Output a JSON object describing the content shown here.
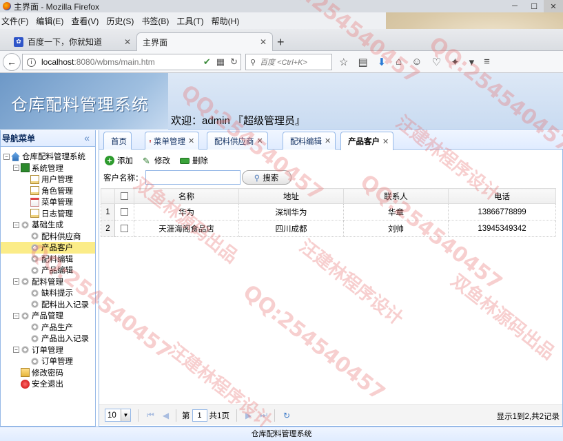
{
  "browser": {
    "window_title": "主界面 - Mozilla Firefox",
    "menus": [
      "文件(F)",
      "编辑(E)",
      "查看(V)",
      "历史(S)",
      "书签(B)",
      "工具(T)",
      "帮助(H)"
    ],
    "tabs": [
      {
        "label": "百度一下，你就知道"
      },
      {
        "label": "主界面"
      }
    ],
    "url_host": "localhost",
    "url_path": ":8080/wbms/main.htm",
    "search_placeholder": "百度 <Ctrl+K>"
  },
  "app": {
    "title": "仓库配料管理系统",
    "welcome": "欢迎：admin 『超级管理员』",
    "footer": "仓库配料管理系统"
  },
  "sidebar": {
    "title": "导航菜单",
    "tree": [
      {
        "label": "仓库配料管理系统",
        "level": 0,
        "icon": "home-icon",
        "exp": "⊟"
      },
      {
        "label": "系统管理",
        "level": 1,
        "icon": "book-icon",
        "exp": "⊟"
      },
      {
        "label": "用户管理",
        "level": 2,
        "icon": "page-icon"
      },
      {
        "label": "角色管理",
        "level": 2,
        "icon": "page-icon"
      },
      {
        "label": "菜单管理",
        "level": 2,
        "icon": "menu-icon"
      },
      {
        "label": "日志管理",
        "level": 2,
        "icon": "page-icon"
      },
      {
        "label": "基础生成",
        "level": 1,
        "icon": "gear-icon",
        "exp": "⊟"
      },
      {
        "label": "配料供应商",
        "level": 2,
        "icon": "gear-icon"
      },
      {
        "label": "产品客户",
        "level": 2,
        "icon": "gear-icon",
        "selected": true
      },
      {
        "label": "配料编辑",
        "level": 2,
        "icon": "gear-icon"
      },
      {
        "label": "产品编辑",
        "level": 2,
        "icon": "gear-icon"
      },
      {
        "label": "配料管理",
        "level": 1,
        "icon": "gear-icon",
        "exp": "⊟"
      },
      {
        "label": "缺料提示",
        "level": 2,
        "icon": "gear-icon"
      },
      {
        "label": "配料出入记录",
        "level": 2,
        "icon": "gear-icon"
      },
      {
        "label": "产品管理",
        "level": 1,
        "icon": "gear-icon",
        "exp": "⊟"
      },
      {
        "label": "产品生产",
        "level": 2,
        "icon": "gear-icon"
      },
      {
        "label": "产品出入记录",
        "level": 2,
        "icon": "gear-icon"
      },
      {
        "label": "订单管理",
        "level": 1,
        "icon": "gear-icon",
        "exp": "⊟"
      },
      {
        "label": "订单管理",
        "level": 2,
        "icon": "gear-icon"
      },
      {
        "label": "修改密码",
        "level": 1,
        "icon": "folder-icon"
      },
      {
        "label": "安全退出",
        "level": 1,
        "icon": "exit-icon"
      }
    ]
  },
  "tabs": [
    {
      "label": "首页",
      "closable": false,
      "icon": "home-icon"
    },
    {
      "label": "菜单管理",
      "closable": true,
      "icon": "menu-icon"
    },
    {
      "label": "配料供应商",
      "closable": true,
      "icon": "gear-icon"
    },
    {
      "label": "配料编辑",
      "closable": true,
      "icon": "gear-icon"
    },
    {
      "label": "产品客户",
      "closable": true,
      "icon": "gear-icon",
      "active": true
    }
  ],
  "toolbar": {
    "add": "添加",
    "edit": "修改",
    "delete": "删除"
  },
  "filter": {
    "label": "客户名称：",
    "value": "",
    "search_button": "搜索"
  },
  "grid": {
    "columns": [
      "名称",
      "地址",
      "联系人",
      "电话"
    ],
    "rows": [
      {
        "num": "1",
        "name": "华为",
        "address": "深圳华为",
        "contact": "华章",
        "phone": "13866778899"
      },
      {
        "num": "2",
        "name": "天涯海阁食品店",
        "address": "四川成都",
        "contact": "刘帅",
        "phone": "13945349342"
      }
    ]
  },
  "pager": {
    "page_size": "10",
    "page_label": "第",
    "page_value": "1",
    "total_pages": "共1页",
    "info": "显示1到2,共2记录"
  },
  "watermarks": [
    "QQ:254540457",
    "双鱼林源码出品",
    "汪建林程序设计"
  ]
}
